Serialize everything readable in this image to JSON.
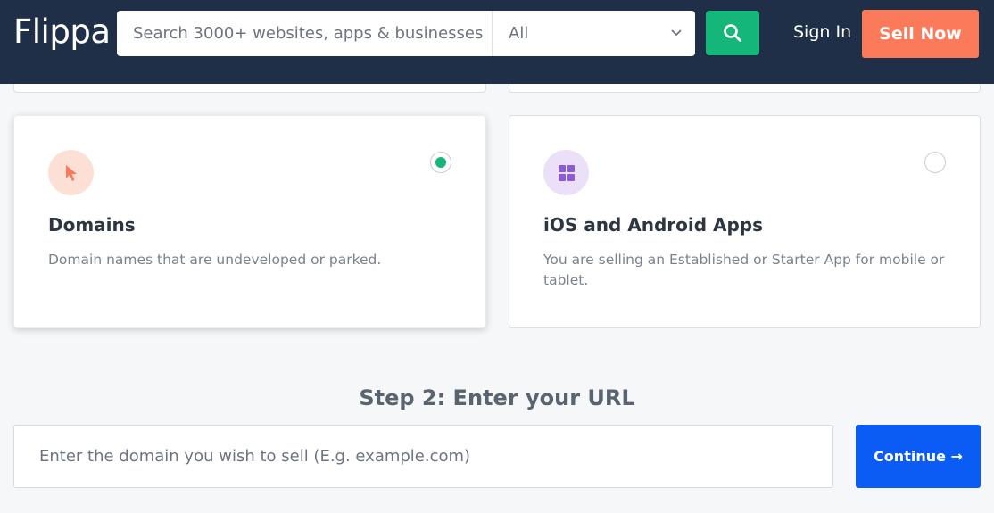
{
  "header": {
    "logo": "Flippa",
    "search_placeholder": "Search 3000+ websites, apps & businesses",
    "category_value": "All",
    "signin_label": "Sign In",
    "sell_label": "Sell Now"
  },
  "cards": [
    {
      "title": "Domains",
      "description": "Domain names that are undeveloped or parked.",
      "icon": "cursor-icon",
      "icon_bg": "#fde0d5",
      "icon_color": "#fb7a5a",
      "selected": true
    },
    {
      "title": "iOS and Android Apps",
      "description": "You are selling an Established or Starter App for mobile or tablet.",
      "icon": "grid-icon",
      "icon_bg": "#ebe0f8",
      "icon_color": "#8b5cd6",
      "selected": false
    }
  ],
  "step2": {
    "heading": "Step 2: Enter your URL",
    "url_placeholder": "Enter the domain you wish to sell (E.g. example.com)",
    "continue_label": "Continue →"
  },
  "colors": {
    "header_bg": "#1f2f47",
    "search_green": "#15b679",
    "sell_orange": "#fb7a5a",
    "continue_blue": "#0a5cf5"
  }
}
